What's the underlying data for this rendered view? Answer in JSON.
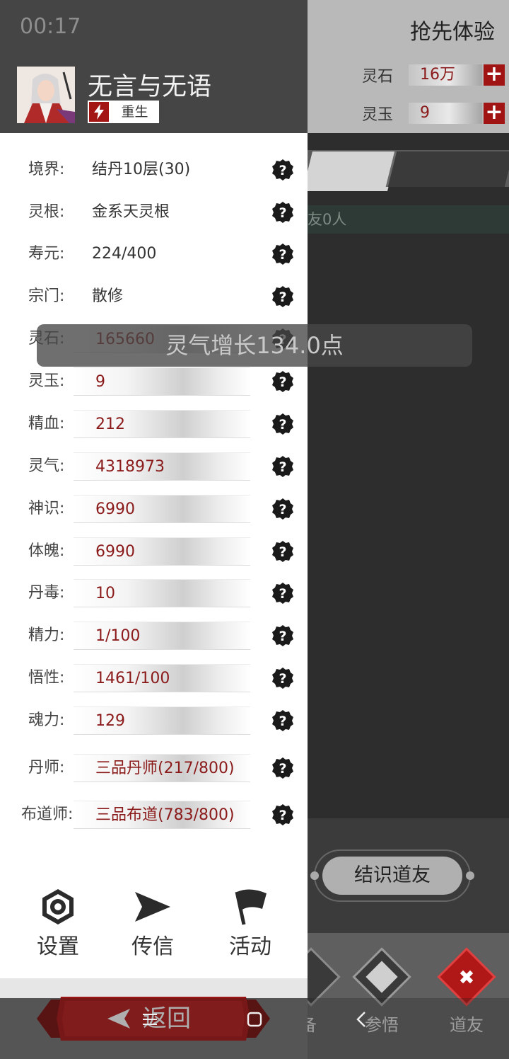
{
  "status_bar": {
    "time": "00:17"
  },
  "background": {
    "title": "抢先体验",
    "resources": [
      {
        "label": "灵石",
        "value": "16万",
        "plus": "+"
      },
      {
        "label": "灵玉",
        "value": "9",
        "plus": "+"
      }
    ],
    "friends_text": "友0人",
    "meet_button": "结识道友",
    "bottom_nav": [
      {
        "label": "备",
        "icon": "partial-nav-icon"
      },
      {
        "label": "参悟",
        "icon": "book-icon"
      },
      {
        "label": "道友",
        "icon": "close-icon"
      }
    ]
  },
  "toast": {
    "text": "灵气增长134.0点"
  },
  "profile": {
    "name": "无言与无语",
    "rebirth_label": "重生",
    "stats": [
      {
        "label": "境界:",
        "value": "结丹10层(30)",
        "boxed": false
      },
      {
        "label": "灵根:",
        "value": "金系天灵根",
        "boxed": false
      },
      {
        "label": "寿元:",
        "value": "224/400",
        "boxed": false
      },
      {
        "label": "宗门:",
        "value": "散修",
        "boxed": false
      },
      {
        "label": "灵石:",
        "value": "165660",
        "boxed": true
      },
      {
        "label": "灵玉:",
        "value": "9",
        "boxed": true
      },
      {
        "label": "精血:",
        "value": "212",
        "boxed": true
      },
      {
        "label": "灵气:",
        "value": "4318973",
        "boxed": true
      },
      {
        "label": "神识:",
        "value": "6990",
        "boxed": true
      },
      {
        "label": "体魄:",
        "value": "6990",
        "boxed": true
      },
      {
        "label": "丹毒:",
        "value": "10",
        "boxed": true
      },
      {
        "label": "精力:",
        "value": "1/100",
        "boxed": true
      },
      {
        "label": "悟性:",
        "value": "1461/100",
        "boxed": true
      },
      {
        "label": "魂力:",
        "value": "129",
        "boxed": true
      },
      {
        "label": "丹师:",
        "value": "三品丹师(217/800)",
        "boxed": true
      },
      {
        "label": "布道师:",
        "value": "三品布道(783/800)",
        "boxed": true
      }
    ],
    "actions": [
      {
        "label": "设置",
        "icon": "settings-icon"
      },
      {
        "label": "传信",
        "icon": "send-icon"
      },
      {
        "label": "活动",
        "icon": "flag-icon"
      }
    ],
    "back_button": "返回"
  },
  "colors": {
    "accent_red": "#a31414",
    "value_red": "#8b1a1a",
    "panel_header": "#454545"
  }
}
